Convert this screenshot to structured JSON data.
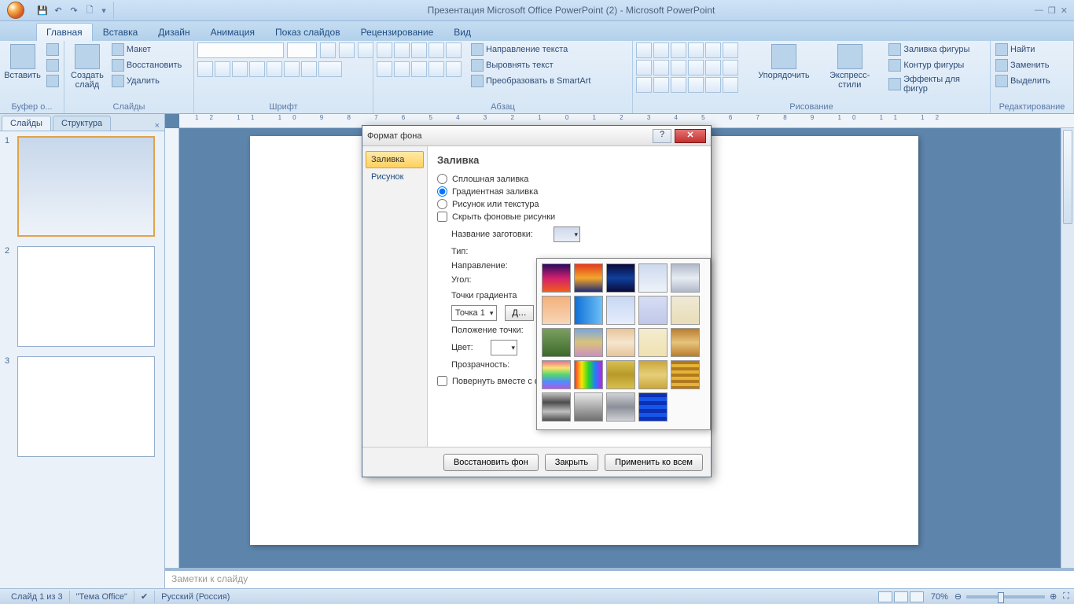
{
  "app": {
    "title": "Презентация Microsoft Office PowerPoint (2) - Microsoft PowerPoint",
    "win_min": "—",
    "win_restore": "❐",
    "win_close": "✕"
  },
  "qat": {
    "save": "💾",
    "undo": "↶",
    "redo": "↷",
    "repeat": "🗋"
  },
  "tabs": [
    "Главная",
    "Вставка",
    "Дизайн",
    "Анимация",
    "Показ слайдов",
    "Рецензирование",
    "Вид"
  ],
  "ribbon": {
    "clipboard": {
      "paste": "Вставить",
      "label": "Буфер о..."
    },
    "slides": {
      "new": "Создать\nслайд",
      "layout": "Макет",
      "reset": "Восстановить",
      "delete": "Удалить",
      "label": "Слайды"
    },
    "font": {
      "label": "Шрифт"
    },
    "paragraph": {
      "textdir": "Направление текста",
      "align": "Выровнять текст",
      "smartart": "Преобразовать в SmartArt",
      "label": "Абзац"
    },
    "drawing": {
      "arrange": "Упорядочить",
      "styles": "Экспресс-стили",
      "fill": "Заливка фигуры",
      "outline": "Контур фигуры",
      "effects": "Эффекты для фигур",
      "label": "Рисование"
    },
    "editing": {
      "find": "Найти",
      "replace": "Заменить",
      "select": "Выделить",
      "label": "Редактирование"
    }
  },
  "slide_panel": {
    "tab_slides": "Слайды",
    "tab_outline": "Структура",
    "close": "×",
    "thumbs": [
      "1",
      "2",
      "3"
    ]
  },
  "ruler_h": "12 11 10 9 8 7 6 5 4 3 2 1 0 1 2 3 4 5 6 7 8 9 10 11 12",
  "notes": "Заметки к слайду",
  "dialog": {
    "title": "Формат фона",
    "help": "?",
    "close": "✕",
    "nav_fill": "Заливка",
    "nav_picture": "Рисунок",
    "heading": "Заливка",
    "opt_solid": "Сплошная заливка",
    "opt_gradient": "Градиентная заливка",
    "opt_picture": "Рисунок или текстура",
    "chk_hide": "Скрыть фоновые рисунки",
    "lbl_preset": "Название заготовки:",
    "lbl_type": "Тип:",
    "lbl_direction": "Направление:",
    "lbl_angle": "Угол:",
    "lbl_stops": "Точки градиента",
    "stop_value": "Точка 1",
    "btn_add": "Д…",
    "lbl_position": "Положение точки:",
    "lbl_color": "Цвет:",
    "lbl_transparency": "Прозрачность:",
    "chk_rotate": "Повернуть вместе с фигурой",
    "btn_reset": "Восстановить фон",
    "btn_close": "Закрыть",
    "btn_applyall": "Применить ко всем"
  },
  "presets": [
    "linear-gradient(#2b0a5e,#d21f6f,#f25d1b)",
    "linear-gradient(#e33a1f,#f3a72a,#1f2a75)",
    "linear-gradient(#0a0a3a,#10409b,#0a0a3a)",
    "linear-gradient(#cdd9ee,#eef3fa)",
    "linear-gradient(#b0b9c9,#e8ecf3,#b0b9c9)",
    "linear-gradient(#f4b07a,#f7d6b8)",
    "linear-gradient(to right,#0f6fd6,#6ec0f7)",
    "linear-gradient(#c7d7f4,#e6edfb)",
    "linear-gradient(#d7ddf3,#c0c8ea)",
    "linear-gradient(#efe9d6,#e8ddb8)",
    "linear-gradient(#7aa060,#3d6a2c)",
    "linear-gradient(#7aa6e0,#d9c37c,#c98fbf)",
    "linear-gradient(#e7c49a,#f5e6cf,#e7c49a)",
    "linear-gradient(#f4ecd0,#efe1b1)",
    "linear-gradient(#b97d2e,#e6c37b,#b97d2e)",
    "linear-gradient(#e46fa0,#ffe16a,#52d66f,#4f8cff,#b15be0)",
    "linear-gradient(to right,#ff3030,#ffe500,#29d629,#1f7cff,#c022e0)",
    "linear-gradient(#d8c04f,#b79a2a,#d8c04f)",
    "linear-gradient(#caa63a,#e6cf7a,#caa63a)",
    "repeating-linear-gradient(#b07a1c 0 4px,#e6b33a 4px 8px)",
    "linear-gradient(#bfbfbf,#4d4d4d,#bfbfbf,#4d4d4d)",
    "linear-gradient(#e8e8e8,#6f6f6f)",
    "linear-gradient(#d0d2d6,#8a8f98,#d0d2d6)",
    "repeating-linear-gradient(#0b2fb5 0 5px,#1557e8 5px 10px)"
  ],
  "status": {
    "slide": "Слайд 1 из 3",
    "theme": "\"Тема Office\"",
    "lang": "Русский (Россия)",
    "zoom": "70%"
  }
}
